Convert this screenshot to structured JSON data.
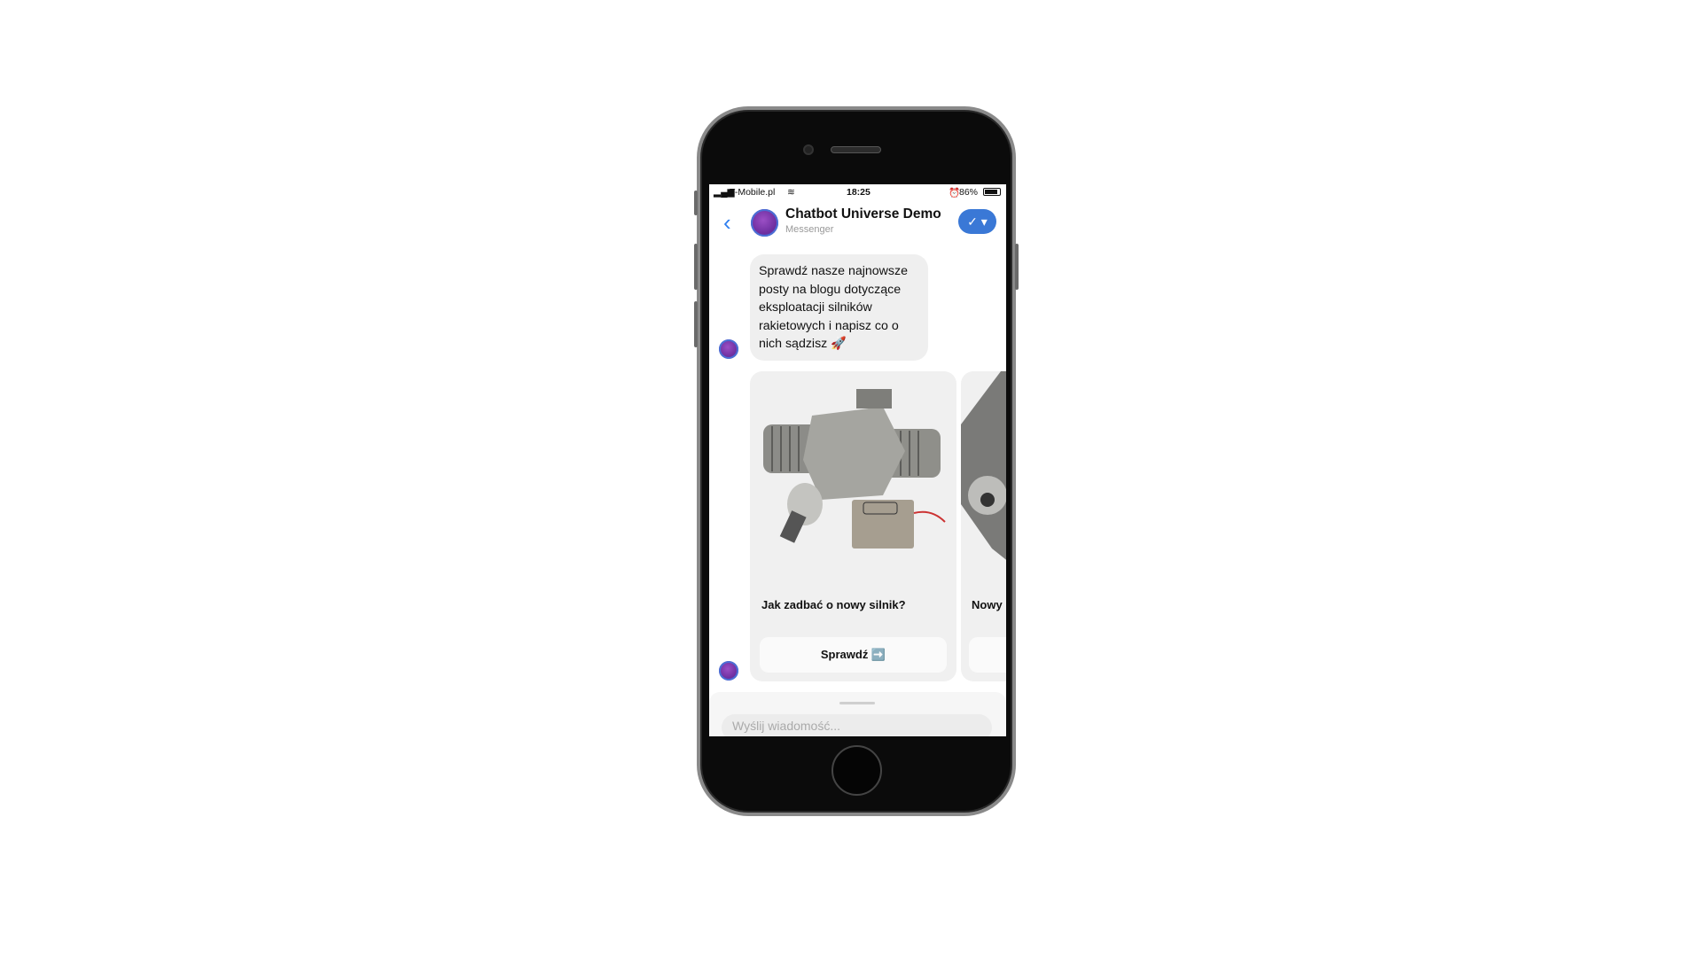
{
  "status_bar": {
    "carrier": "T-Mobile.pl",
    "time": "18:25",
    "battery": "86%",
    "battery_level": 0.86
  },
  "header": {
    "back_icon": "chevron-left-icon",
    "title": "Chatbot Universe Demo",
    "subtitle": "Messenger",
    "action_icon": "check-dropdown-icon"
  },
  "messages": [
    {
      "text": "Sprawdź nasze najnowsze posty na blogu dotyczące eksploatacji silników rakietowych i napisz co o nich sądzisz 🚀"
    }
  ],
  "carousel": [
    {
      "title": "Jak zadbać o nowy silnik?",
      "button": "Sprawdź ➡️"
    },
    {
      "title": "Nowy",
      "button": ""
    }
  ],
  "composer": {
    "placeholder": "Wyślij wiadomość..."
  },
  "colors": {
    "accent": "#3a78d6",
    "back": "#2f7ff0",
    "bubble": "#efefef"
  }
}
